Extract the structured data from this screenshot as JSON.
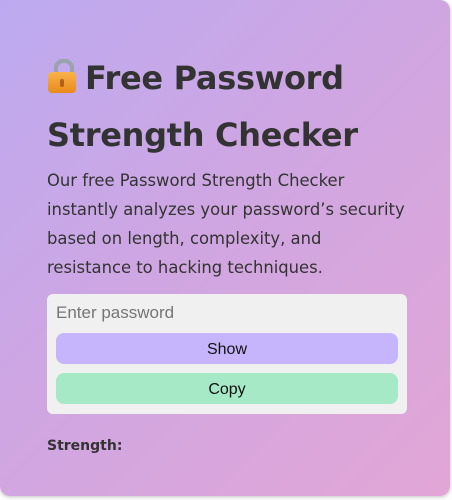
{
  "header": {
    "title": "Free Password Strength Checker",
    "title_icon": "lock-icon"
  },
  "description": "Our free Password Strength Checker instantly analyzes your password’s security based on length, complexity, and resistance to hacking techniques.",
  "form": {
    "password_placeholder": "Enter password",
    "password_value": "",
    "show_label": "Show",
    "copy_label": "Copy"
  },
  "result": {
    "strength_label": "Strength:"
  },
  "colors": {
    "gradient_start": "#bcaaf0",
    "gradient_end": "#e2a6d6",
    "show_button": "#c6b5fc",
    "copy_button": "#a6e9c7",
    "panel": "#f0f0f0",
    "text": "#333333"
  }
}
